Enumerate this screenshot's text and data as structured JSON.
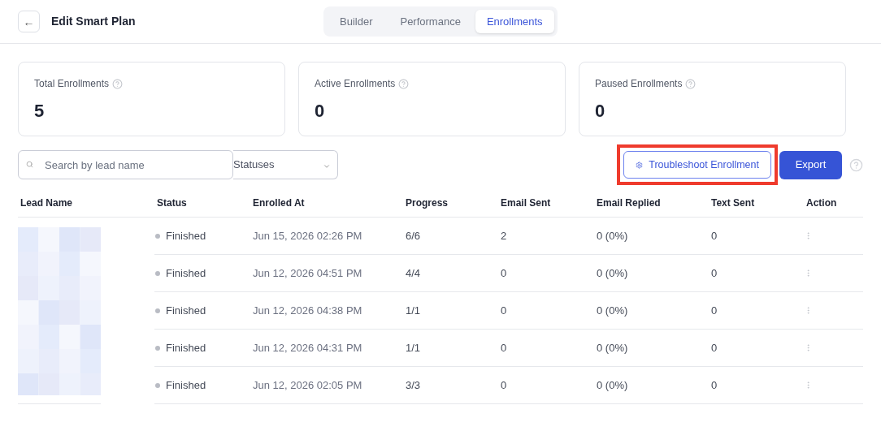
{
  "header": {
    "back": "←",
    "title": "Edit Smart Plan"
  },
  "tabs": [
    {
      "label": "Builder",
      "selected": false
    },
    {
      "label": "Performance",
      "selected": false
    },
    {
      "label": "Enrollments",
      "selected": true
    }
  ],
  "stats": [
    {
      "label": "Total Enrollments",
      "value": "5"
    },
    {
      "label": "Active Enrollments",
      "value": "0"
    },
    {
      "label": "Paused Enrollments",
      "value": "0"
    }
  ],
  "search": {
    "placeholder": "Search by lead name"
  },
  "status_filter": {
    "value": "Statuses"
  },
  "troubleshoot": {
    "label": "Troubleshoot Enrollment",
    "highlighted": true
  },
  "export": {
    "label": "Export"
  },
  "table": {
    "columns": [
      "Lead Name",
      "Status",
      "Enrolled At",
      "Progress",
      "Email Sent",
      "Email Replied",
      "Text Sent",
      "Action"
    ],
    "rows": [
      {
        "status": "Finished",
        "enrolled_at": "Jun 15, 2026 02:26 PM",
        "progress": "6/6",
        "email_sent": "2",
        "email_replied": "0 (0%)",
        "text_sent": "0"
      },
      {
        "status": "Finished",
        "enrolled_at": "Jun 12, 2026 04:51 PM",
        "progress": "4/4",
        "email_sent": "0",
        "email_replied": "0 (0%)",
        "text_sent": "0"
      },
      {
        "status": "Finished",
        "enrolled_at": "Jun 12, 2026 04:38 PM",
        "progress": "1/1",
        "email_sent": "0",
        "email_replied": "0 (0%)",
        "text_sent": "0"
      },
      {
        "status": "Finished",
        "enrolled_at": "Jun 12, 2026 04:31 PM",
        "progress": "1/1",
        "email_sent": "0",
        "email_replied": "0 (0%)",
        "text_sent": "0"
      },
      {
        "status": "Finished",
        "enrolled_at": "Jun 12, 2026 02:05 PM",
        "progress": "3/3",
        "email_sent": "0",
        "email_replied": "0 (0%)",
        "text_sent": "0"
      }
    ]
  }
}
